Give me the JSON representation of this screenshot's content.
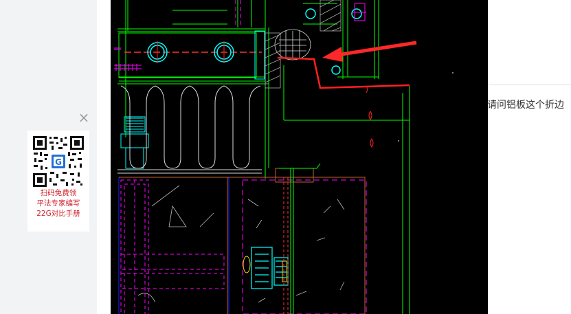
{
  "sidebar": {
    "close_glyph": "×",
    "promo": {
      "lines": [
        "扫码免费领",
        "平法专家编写",
        "22G对比手册"
      ],
      "qr_badge": "G"
    }
  },
  "post": {
    "question_text": "请问铝板这个折边"
  },
  "colors": {
    "caption_red": "#d0222b",
    "cad_background": "#000000",
    "cad_green": "#00ff00",
    "cad_magenta": "#ff00ff",
    "cad_cyan": "#00ffff",
    "cad_orange": "#c0622a",
    "cad_blue": "#1818ff",
    "annotation_red": "#ff2020"
  },
  "icons": {
    "close": "close-icon",
    "qr": "qr-code-icon",
    "arrow": "annotation-arrow-icon"
  }
}
